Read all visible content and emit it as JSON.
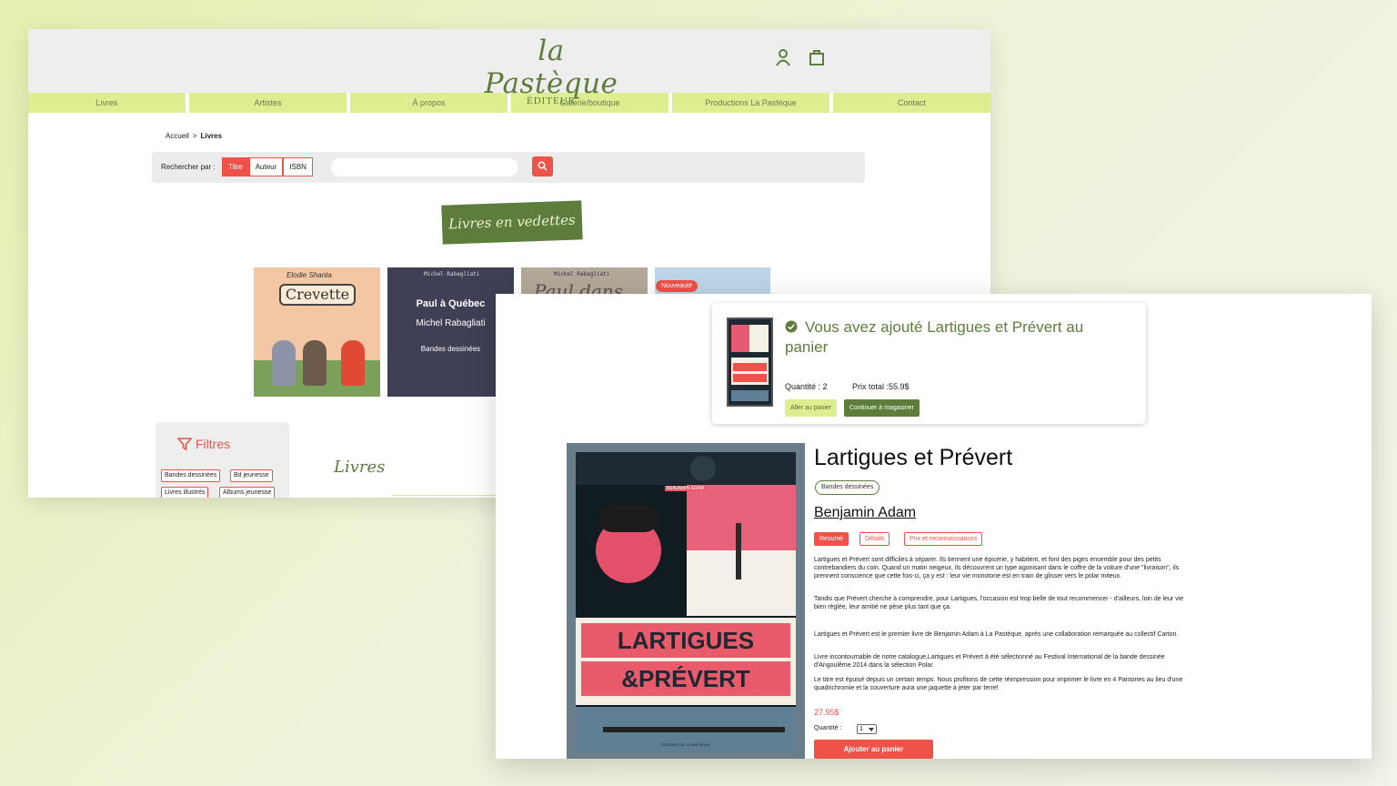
{
  "back_page": {
    "logo": {
      "script": "la Pastèque",
      "sub": "ÉDITEUR"
    },
    "header_icons": [
      "user-icon",
      "cart-icon"
    ],
    "nav": [
      "Livres",
      "Artistes",
      "À propos",
      "Galerie/boutique",
      "Productions La Pastèque",
      "Contact"
    ],
    "breadcrumb": {
      "home": "Accueil",
      "sep": ">",
      "current": "Livres"
    },
    "search": {
      "label": "Rechercher par :",
      "options": [
        "Titre",
        "Auteur",
        "ISBN"
      ],
      "selected": "Titre",
      "placeholder": ""
    },
    "featured_title": "Livres en vedettes",
    "covers": [
      {
        "author": "Elodie Shanta",
        "title": "Crevette"
      },
      {
        "author_top": "Michel Rabagliati",
        "title": "Paul à Québec",
        "author": "Michel Rabagliati",
        "genre": "Bandes dessinées"
      },
      {
        "author_top": "Michel Rabagliati",
        "script": "Paul dans"
      },
      {
        "badge": "Nouveauté"
      }
    ],
    "filters": {
      "title": "Filtres",
      "chips": [
        "Bandes dessinées",
        "Bd jeunesse",
        "Livres illustrés",
        "Albums jeunesse"
      ]
    },
    "books_heading": "Livres"
  },
  "front_page": {
    "toast": {
      "message": "Vous avez ajouté Lartigues et Prévert au panier",
      "quantity": "Quantité : 2",
      "total": "Prix total :55.9$",
      "go_cart": "Aller au panier",
      "continue": "Continuer à magasiner"
    },
    "product": {
      "title": "Lartigues et Prévert",
      "genre": "Bandes dessinées",
      "author": "Benjamin Adam",
      "tabs": [
        "Resumé",
        "Détails",
        "Prix et reconnaissances"
      ],
      "active_tab": "Resumé",
      "cover": {
        "author": "BENJAMIN ADAM",
        "title_line1": "LARTIGUES",
        "title_line2": "&PRÉVERT",
        "publisher": "ÉDITIONS DE LA PASTÈQUE"
      },
      "paragraphs": [
        "Lartigues et Prévert sont difficiles à séparer. Ils tiennent une épicerie, y habitent, et font des piges ensemble pour des petits contrebandiers du coin. Quand un matin neigeux, ils découvrent un type agonisant dans le coffre de la voiture d'une \"livraison\", ils prennent conscience que cette fois-ci, ça y est : leur vie monotone est en train de glisser vers le polar miteux.",
        "Tandis que Prévert cherche à comprendre, pour Lartigues, l'occasion est trop belle de tout recommencer - d'ailleurs, loin de leur vie bien réglée, leur amitié ne pèse plus tant que ça.",
        "Lartigues et Prévert est le premier livre de Benjamin Adam à La Pastèque, après une collaboration remarquée au collectif Carton.",
        "Livre incontournable de notre catalogue,Lartigues et Prévert à été sélectionné au Festival International de la bande dessinée d'Angoulême 2014 dans la sélection Polar.",
        "Le titre est épuisé depuis un certain temps. Nous profitons de cette réimpression pour imprimer le livre en 4 Pantones au lieu d'une quadrichromie et la couverture aura une jaquette à jeter par terre!"
      ],
      "price": "27.95$",
      "quantity_label": "Quantité :",
      "quantity_value": "1",
      "add_to_cart": "Ajouter au panier"
    }
  },
  "colors": {
    "accent": "#ee5248",
    "brand_green": "#5c7d3b",
    "nav_lime": "#dcee8f"
  }
}
